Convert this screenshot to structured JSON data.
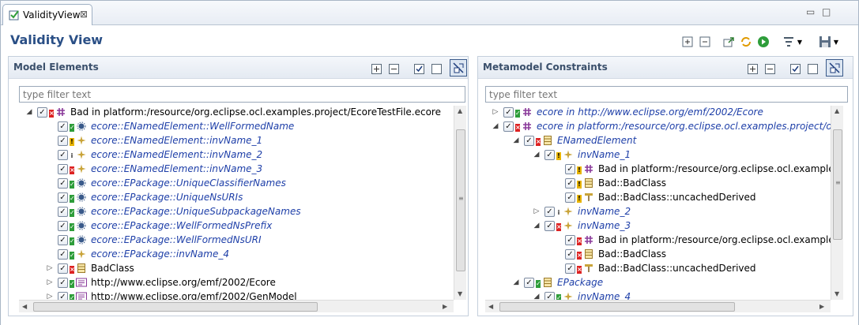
{
  "tab": {
    "label": "ValidityView",
    "close": "⊠"
  },
  "title": "Validity View",
  "left": {
    "header": "Model Elements",
    "filter_placeholder": "type filter text",
    "rows": [
      {
        "indent": 0,
        "tw": "◢",
        "checked": true,
        "status": "err",
        "icon": "package-icon",
        "text": "Bad in platform:/resource/org.eclipse.ocl.examples.project/EcoreTestFile.ecore",
        "italic": false
      },
      {
        "indent": 1,
        "tw": "",
        "checked": true,
        "status": "ok",
        "icon": "constraint-icon",
        "text": "ecore::ENamedElement::WellFormedName",
        "italic": true
      },
      {
        "indent": 1,
        "tw": "",
        "checked": true,
        "status": "warn",
        "icon": "invariant-icon",
        "text": "ecore::ENamedElement::invName_1",
        "italic": true
      },
      {
        "indent": 1,
        "tw": "",
        "checked": true,
        "status": "info",
        "icon": "invariant-icon",
        "text": "ecore::ENamedElement::invName_2",
        "italic": true
      },
      {
        "indent": 1,
        "tw": "",
        "checked": true,
        "status": "err",
        "icon": "invariant-icon",
        "text": "ecore::ENamedElement::invName_3",
        "italic": true
      },
      {
        "indent": 1,
        "tw": "",
        "checked": true,
        "status": "ok",
        "icon": "constraint-icon",
        "text": "ecore::EPackage::UniqueClassifierNames",
        "italic": true
      },
      {
        "indent": 1,
        "tw": "",
        "checked": true,
        "status": "ok",
        "icon": "constraint-icon",
        "text": "ecore::EPackage::UniqueNsURIs",
        "italic": true
      },
      {
        "indent": 1,
        "tw": "",
        "checked": true,
        "status": "ok",
        "icon": "constraint-icon",
        "text": "ecore::EPackage::UniqueSubpackageNames",
        "italic": true
      },
      {
        "indent": 1,
        "tw": "",
        "checked": true,
        "status": "ok",
        "icon": "constraint-icon",
        "text": "ecore::EPackage::WellFormedNsPrefix",
        "italic": true
      },
      {
        "indent": 1,
        "tw": "",
        "checked": true,
        "status": "ok",
        "icon": "constraint-icon",
        "text": "ecore::EPackage::WellFormedNsURI",
        "italic": true
      },
      {
        "indent": 1,
        "tw": "",
        "checked": true,
        "status": "ok",
        "icon": "invariant-icon",
        "text": "ecore::EPackage::invName_4",
        "italic": true
      },
      {
        "indent": 1,
        "tw": "▷",
        "checked": true,
        "status": "err",
        "icon": "class-icon",
        "text": "BadClass",
        "italic": false
      },
      {
        "indent": 1,
        "tw": "▷",
        "checked": true,
        "status": "ok",
        "icon": "model-icon",
        "text": "http://www.eclipse.org/emf/2002/Ecore",
        "italic": false
      },
      {
        "indent": 1,
        "tw": "▷",
        "checked": true,
        "status": "ok",
        "icon": "model-icon",
        "text": "http://www.eclipse.org/emf/2002/GenModel",
        "italic": false
      }
    ]
  },
  "right": {
    "header": "Metamodel Constraints",
    "filter_placeholder": "type filter text",
    "rows": [
      {
        "indent": 0,
        "tw": "▷",
        "checked": true,
        "status": "ok",
        "icon": "package-icon",
        "text": "ecore in http://www.eclipse.org/emf/2002/Ecore",
        "italic": true
      },
      {
        "indent": 0,
        "tw": "◢",
        "checked": true,
        "status": "err",
        "icon": "package-icon",
        "text": "ecore in platform:/resource/org.eclipse.ocl.examples.project/ocl-rules/",
        "italic": true
      },
      {
        "indent": 1,
        "tw": "◢",
        "checked": true,
        "status": "err",
        "icon": "class-icon",
        "text": "ENamedElement",
        "italic": true
      },
      {
        "indent": 2,
        "tw": "◢",
        "checked": true,
        "status": "warn",
        "icon": "invariant-icon",
        "text": "invName_1",
        "italic": true
      },
      {
        "indent": 3,
        "tw": "",
        "checked": true,
        "status": "warn",
        "icon": "package-icon",
        "text": "Bad in platform:/resource/org.eclipse.ocl.examples.pro",
        "italic": false
      },
      {
        "indent": 3,
        "tw": "",
        "checked": true,
        "status": "warn",
        "icon": "class-icon",
        "text": "Bad::BadClass",
        "italic": false
      },
      {
        "indent": 3,
        "tw": "",
        "checked": true,
        "status": "warn",
        "icon": "attribute-icon",
        "text": "Bad::BadClass::uncachedDerived",
        "italic": false
      },
      {
        "indent": 2,
        "tw": "▷",
        "checked": true,
        "status": "info",
        "icon": "invariant-icon",
        "text": "invName_2",
        "italic": true
      },
      {
        "indent": 2,
        "tw": "◢",
        "checked": true,
        "status": "err",
        "icon": "invariant-icon",
        "text": "invName_3",
        "italic": true
      },
      {
        "indent": 3,
        "tw": "",
        "checked": true,
        "status": "err",
        "icon": "package-icon",
        "text": "Bad in platform:/resource/org.eclipse.ocl.examples.pro",
        "italic": false
      },
      {
        "indent": 3,
        "tw": "",
        "checked": true,
        "status": "err",
        "icon": "class-icon",
        "text": "Bad::BadClass",
        "italic": false
      },
      {
        "indent": 3,
        "tw": "",
        "checked": true,
        "status": "err",
        "icon": "attribute-icon",
        "text": "Bad::BadClass::uncachedDerived",
        "italic": false
      },
      {
        "indent": 1,
        "tw": "◢",
        "checked": true,
        "status": "ok",
        "icon": "class-icon",
        "text": "EPackage",
        "italic": true
      },
      {
        "indent": 2,
        "tw": "◢",
        "checked": true,
        "status": "ok",
        "icon": "invariant-icon",
        "text": "invName_4",
        "italic": true
      }
    ]
  },
  "colors": {
    "title": "#2a4f86",
    "italic_link": "#1e3fa8",
    "ok": "#2e9d3a",
    "err": "#dd2222",
    "warn": "#e8b400"
  }
}
